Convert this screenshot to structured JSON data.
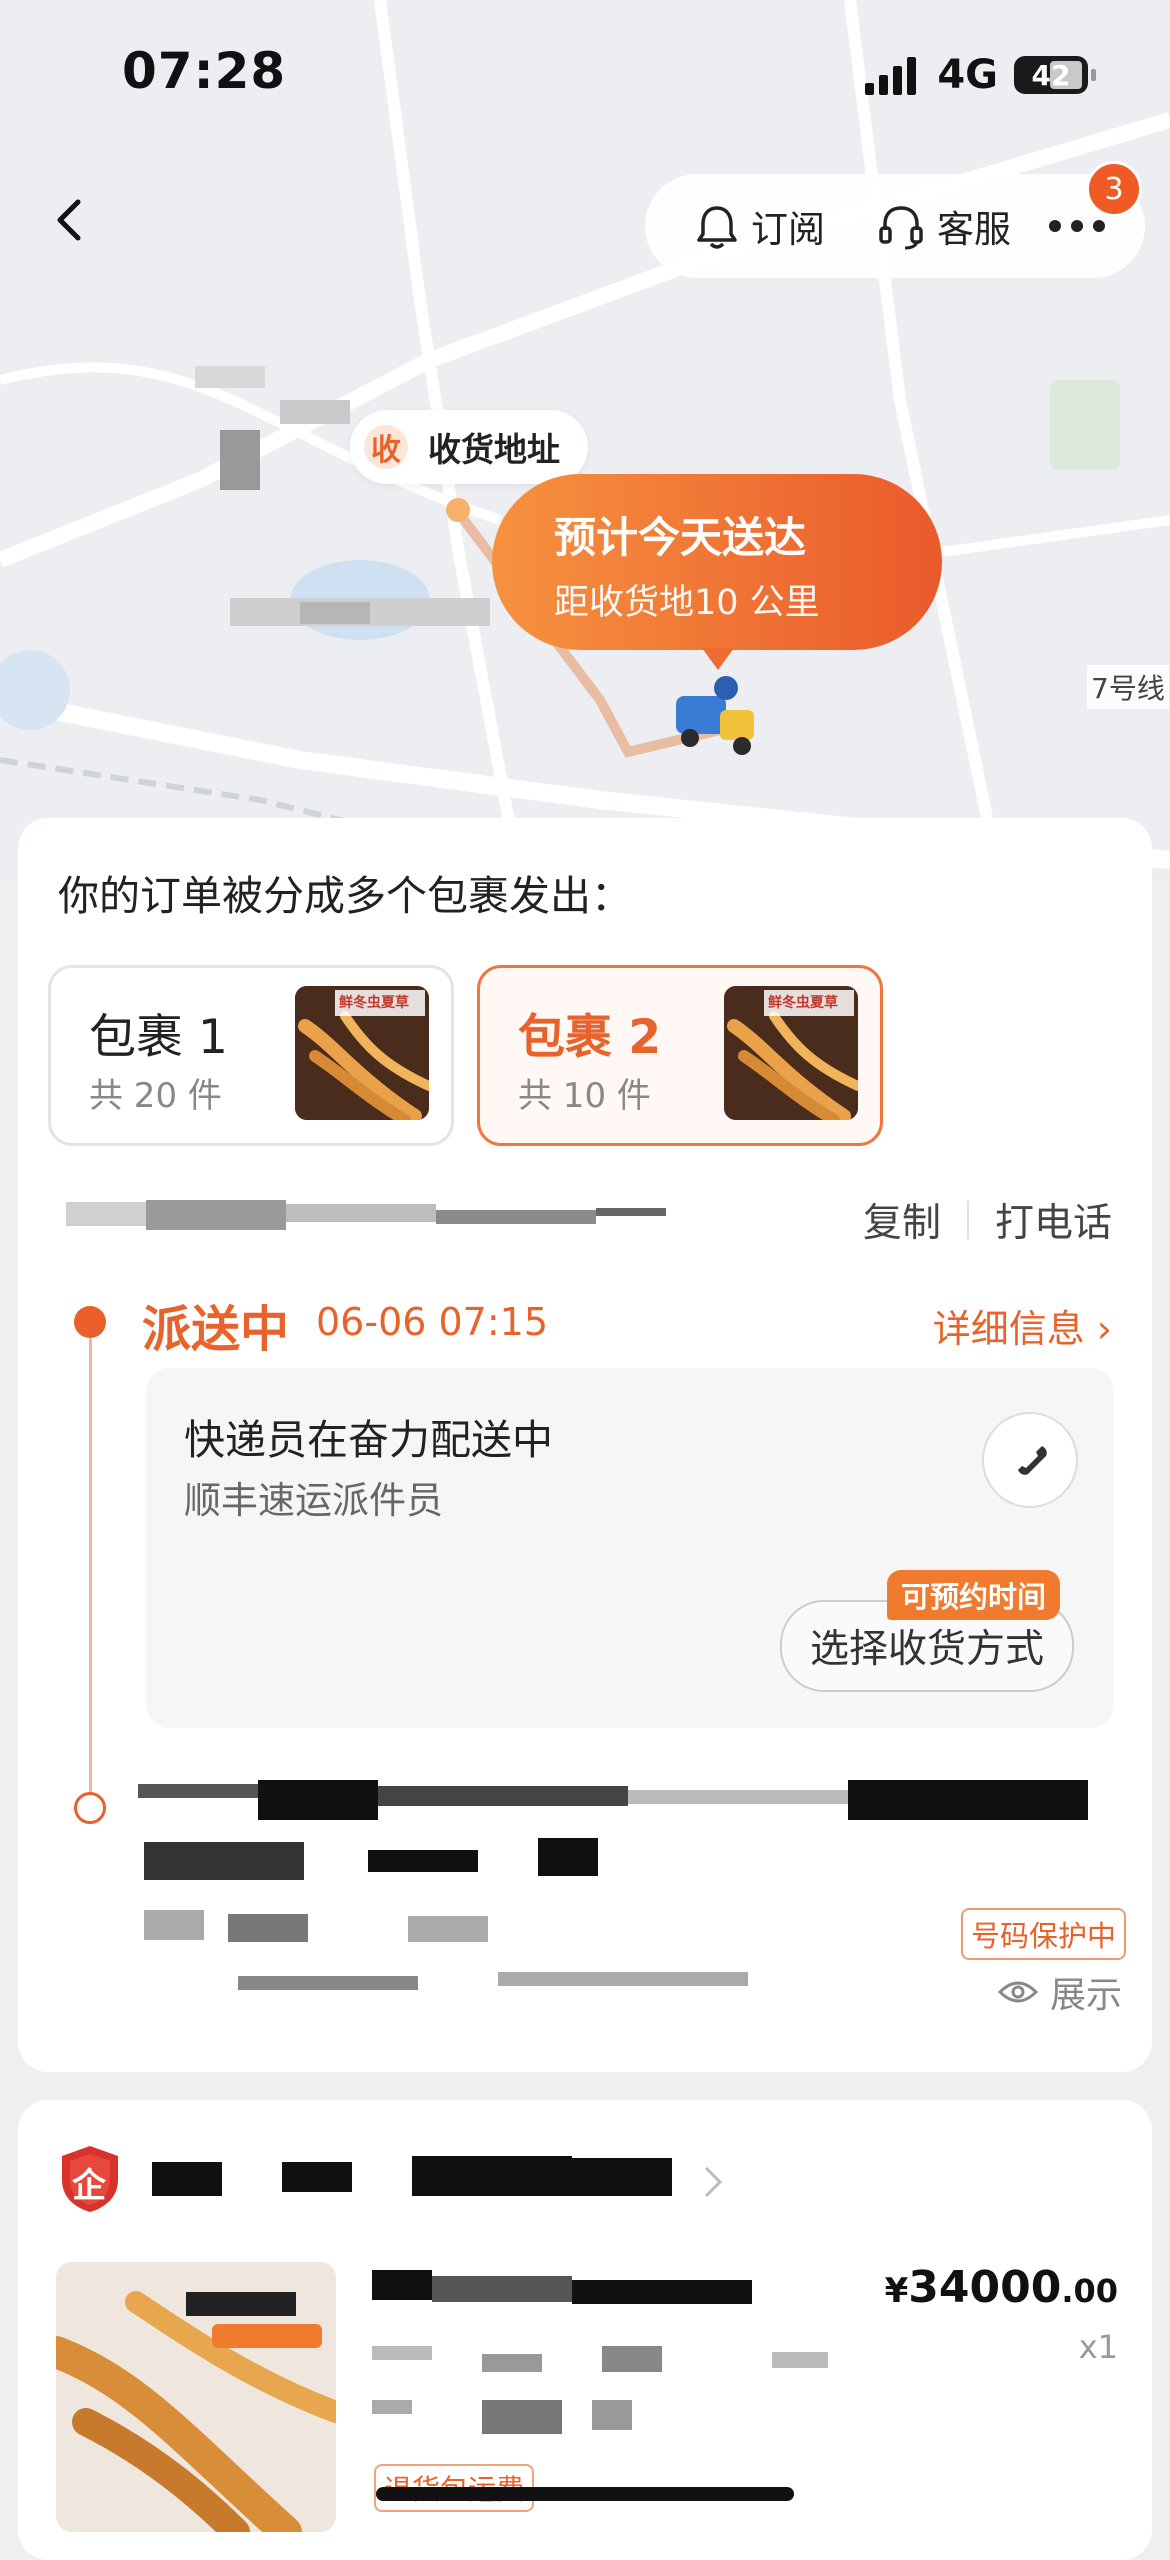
{
  "status_bar": {
    "time": "07:28",
    "network": "4G",
    "battery": "42"
  },
  "topbar": {
    "subscribe_label": "订阅",
    "service_label": "客服",
    "more_badge": "3"
  },
  "map": {
    "address_mark": "收",
    "address_label": "收货地址",
    "eta_title": "预计今天送达",
    "eta_distance": "距收货地10 公里",
    "metro_label": "7号线"
  },
  "order": {
    "split_title": "你的订单被分成多个包裹发出：",
    "packages": [
      {
        "name": "包裹 1",
        "count": "共 20 件",
        "thumb_label": "鲜冬虫夏草"
      },
      {
        "name": "包裹 2",
        "count": "共 10 件",
        "thumb_label": "鲜冬虫夏草"
      }
    ],
    "copy_label": "复制",
    "call_label": "打电话",
    "status": "派送中",
    "status_time": "06-06 07:15",
    "detail_label": "详细信息 ›",
    "courier_title": "快递员在奋力配送中",
    "courier_sub": "顺丰速运派件员",
    "appointment_tag": "可预约时间",
    "choose_label": "选择收货方式",
    "protect_tag": "号码保护中",
    "show_label": "展示"
  },
  "shop": {
    "shop_icon_text": "企",
    "price_symbol": "¥",
    "price_int": "34000",
    "price_dec": ".00",
    "quantity": "x1",
    "refund_tag": "退货包运费"
  },
  "colors": {
    "accent": "#e8632c",
    "accent_light": "#f6923f"
  }
}
